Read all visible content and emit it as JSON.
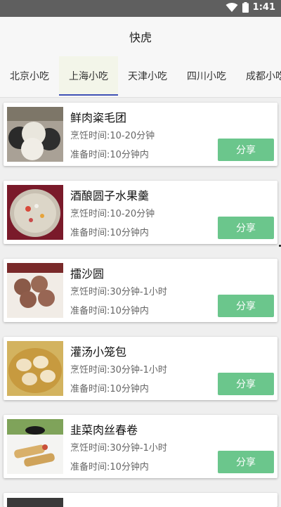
{
  "status": {
    "time": "1:41"
  },
  "app": {
    "title": "快虎"
  },
  "tabs": [
    {
      "label": "北京小吃"
    },
    {
      "label": "上海小吃"
    },
    {
      "label": "天津小吃"
    },
    {
      "label": "四川小吃"
    },
    {
      "label": "成都小吃"
    }
  ],
  "recipes": [
    {
      "name": "鲜肉粢毛团",
      "cook": "烹饪时间:10-20分钟",
      "prep": "准备时间:10分钟内",
      "share": "分享"
    },
    {
      "name": "酒酿圆子水果羹",
      "cook": "烹饪时间:10-20分钟",
      "prep": "准备时间:10分钟内",
      "share": "分享"
    },
    {
      "name": "擂沙圆",
      "cook": "烹饪时间:30分钟-1小时",
      "prep": "准备时间:10分钟内",
      "share": "分享"
    },
    {
      "name": "灌汤小笼包",
      "cook": "烹饪时间:30分钟-1小时",
      "prep": "准备时间:10分钟内",
      "share": "分享"
    },
    {
      "name": "韭菜肉丝春卷",
      "cook": "烹饪时间:30分钟-1小时",
      "prep": "准备时间:10分钟内",
      "share": "分享"
    }
  ],
  "colors": {
    "accent": "#3f51b5",
    "share_button": "#6bc68c",
    "status_bar": "#5f5f5f"
  }
}
